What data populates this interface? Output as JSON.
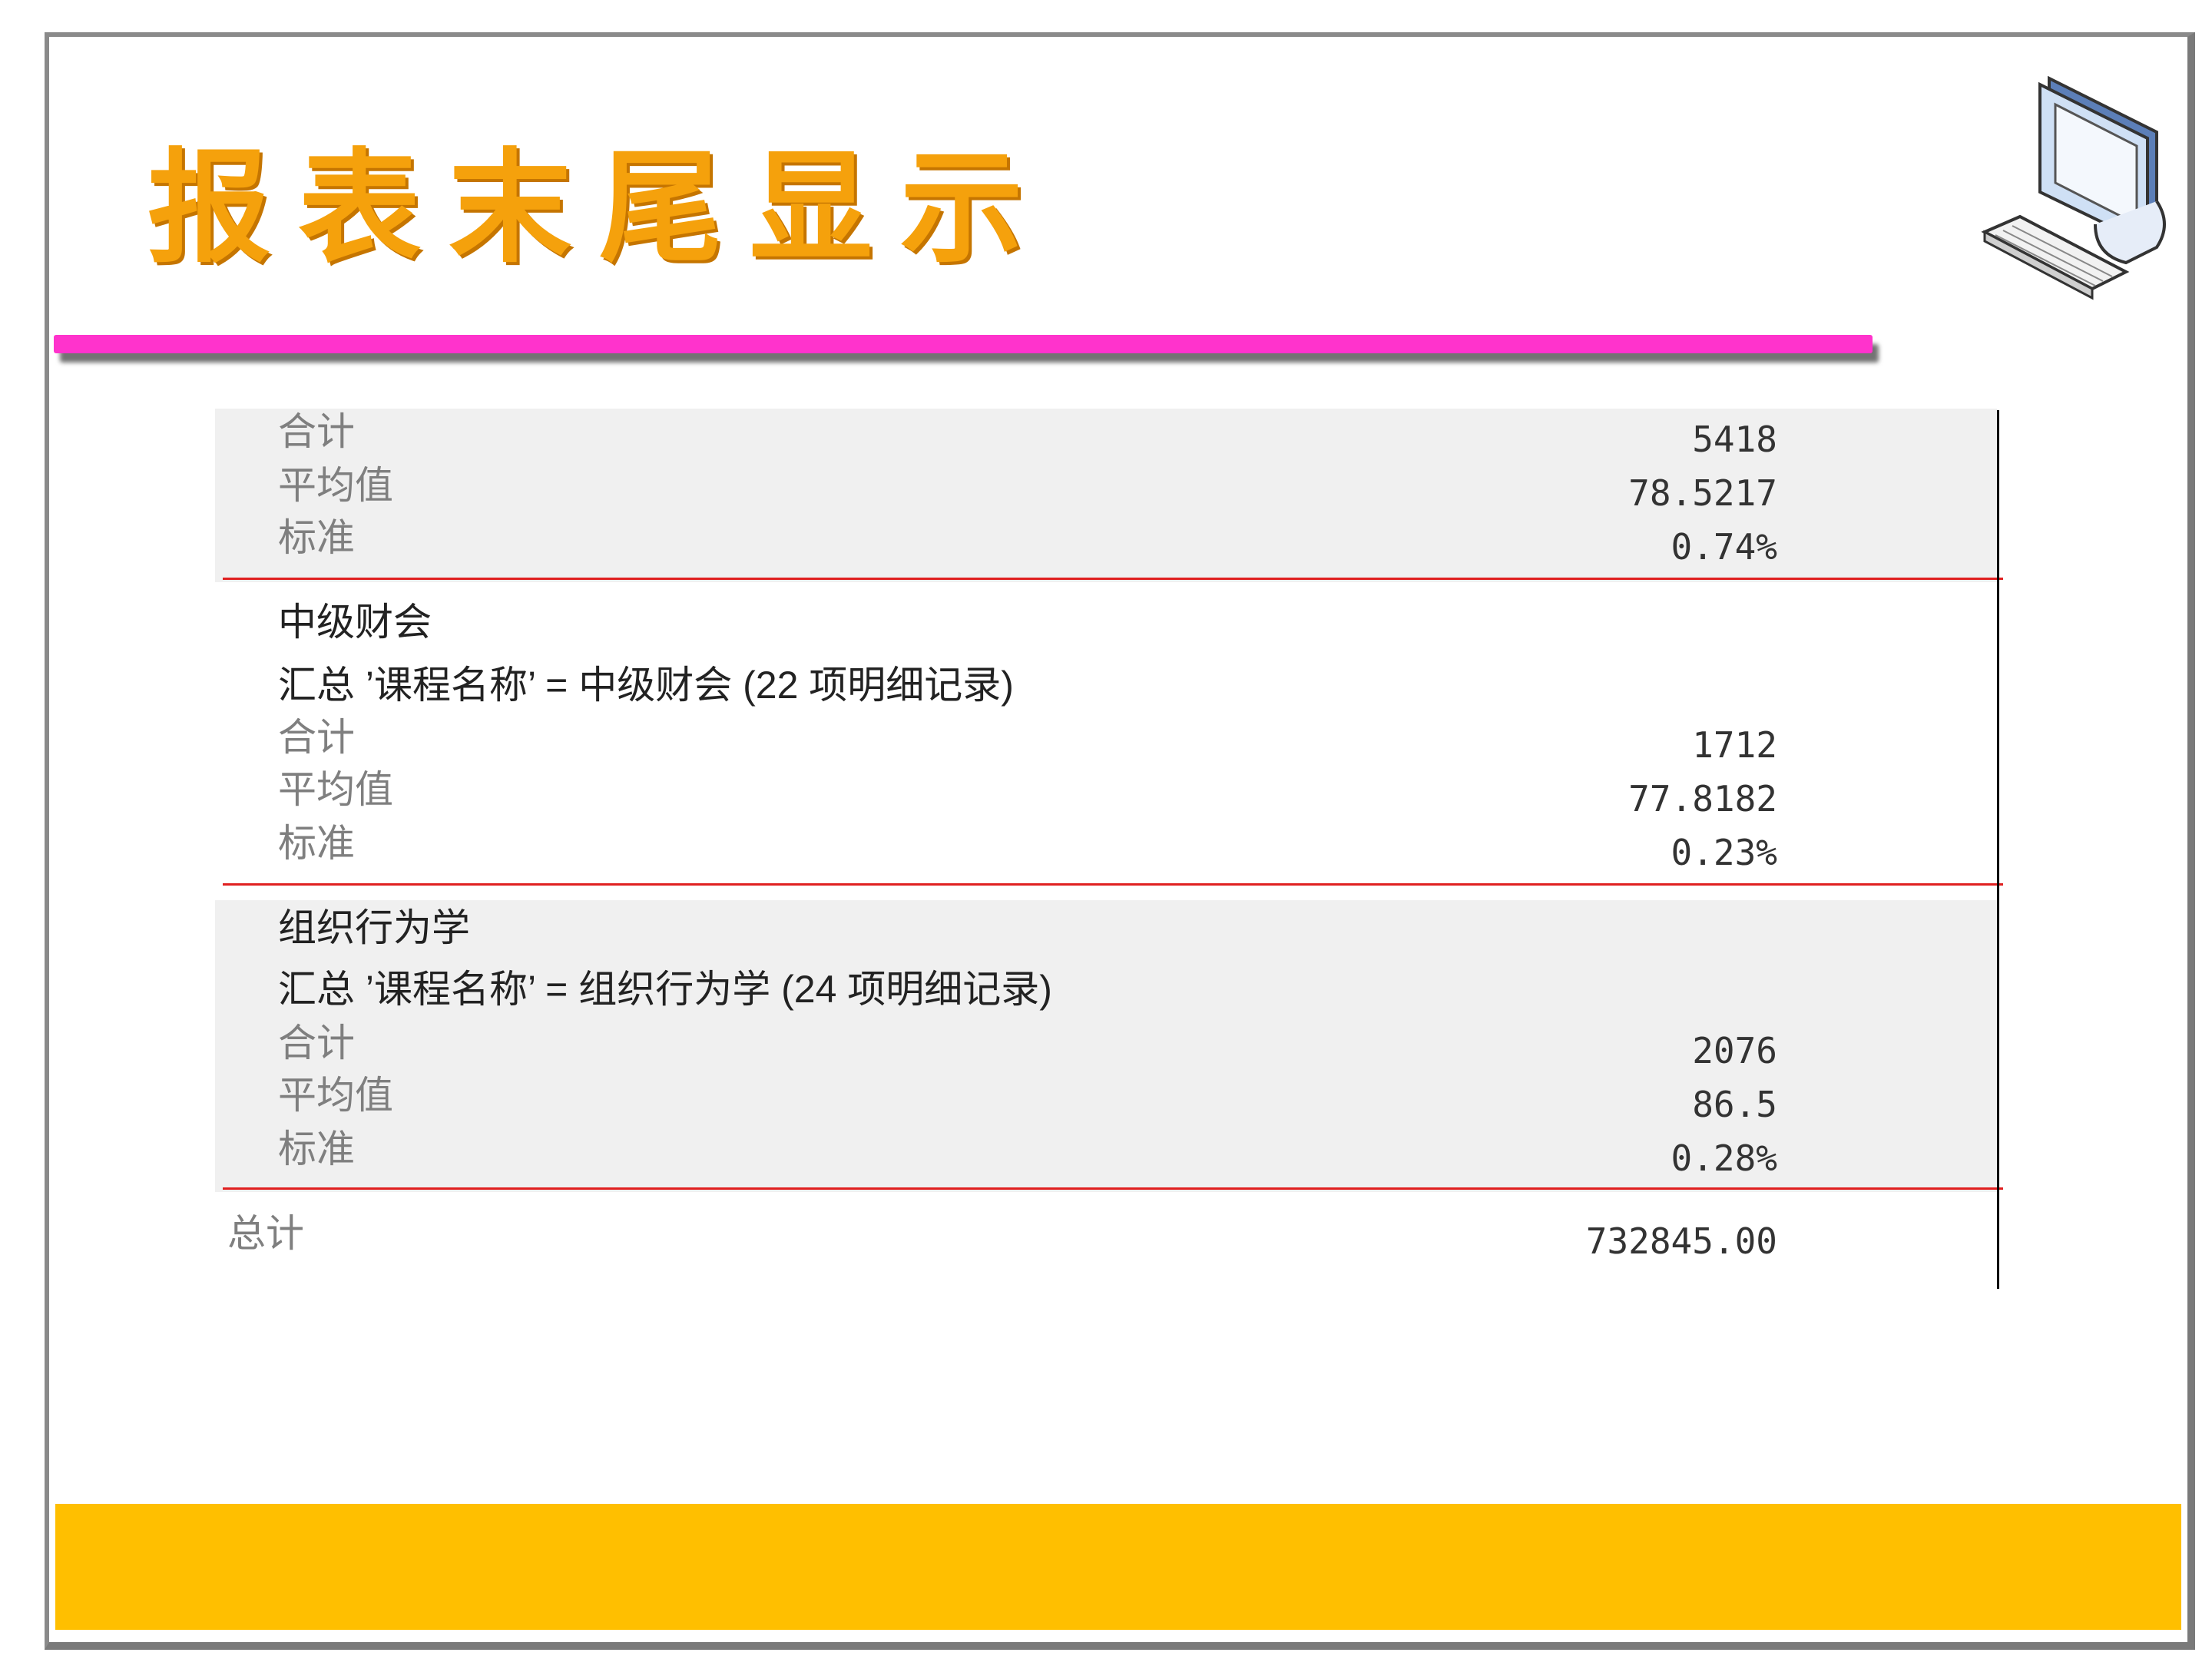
{
  "slide": {
    "title": "报表末尾显示",
    "colors": {
      "title": "#f5a10c",
      "title_bar": "#ff33cc",
      "bottom_bar": "#ffbf00",
      "separator": "#e02020"
    },
    "icon": "desktop-computer-icon"
  },
  "report": {
    "group_prev": {
      "rows": [
        {
          "label": "合计",
          "value": "5418"
        },
        {
          "label": "平均值",
          "value": "78.5217"
        },
        {
          "label": "标准",
          "value": "0.74%"
        }
      ]
    },
    "group_1": {
      "name": "中级财会",
      "summary": "汇总 ’课程名称’ =  中级财会 (22 项明细记录)",
      "rows": [
        {
          "label": "合计",
          "value": "1712"
        },
        {
          "label": "平均值",
          "value": "77.8182"
        },
        {
          "label": "标准",
          "value": "0.23%"
        }
      ]
    },
    "group_2": {
      "name": "组织行为学",
      "summary": "汇总 ’课程名称’ =  组织行为学 (24 项明细记录)",
      "rows": [
        {
          "label": "合计",
          "value": "2076"
        },
        {
          "label": "平均值",
          "value": "86.5"
        },
        {
          "label": "标准",
          "value": "0.28%"
        }
      ]
    },
    "grand_total": {
      "label": "总计",
      "value": "732845.00"
    }
  }
}
